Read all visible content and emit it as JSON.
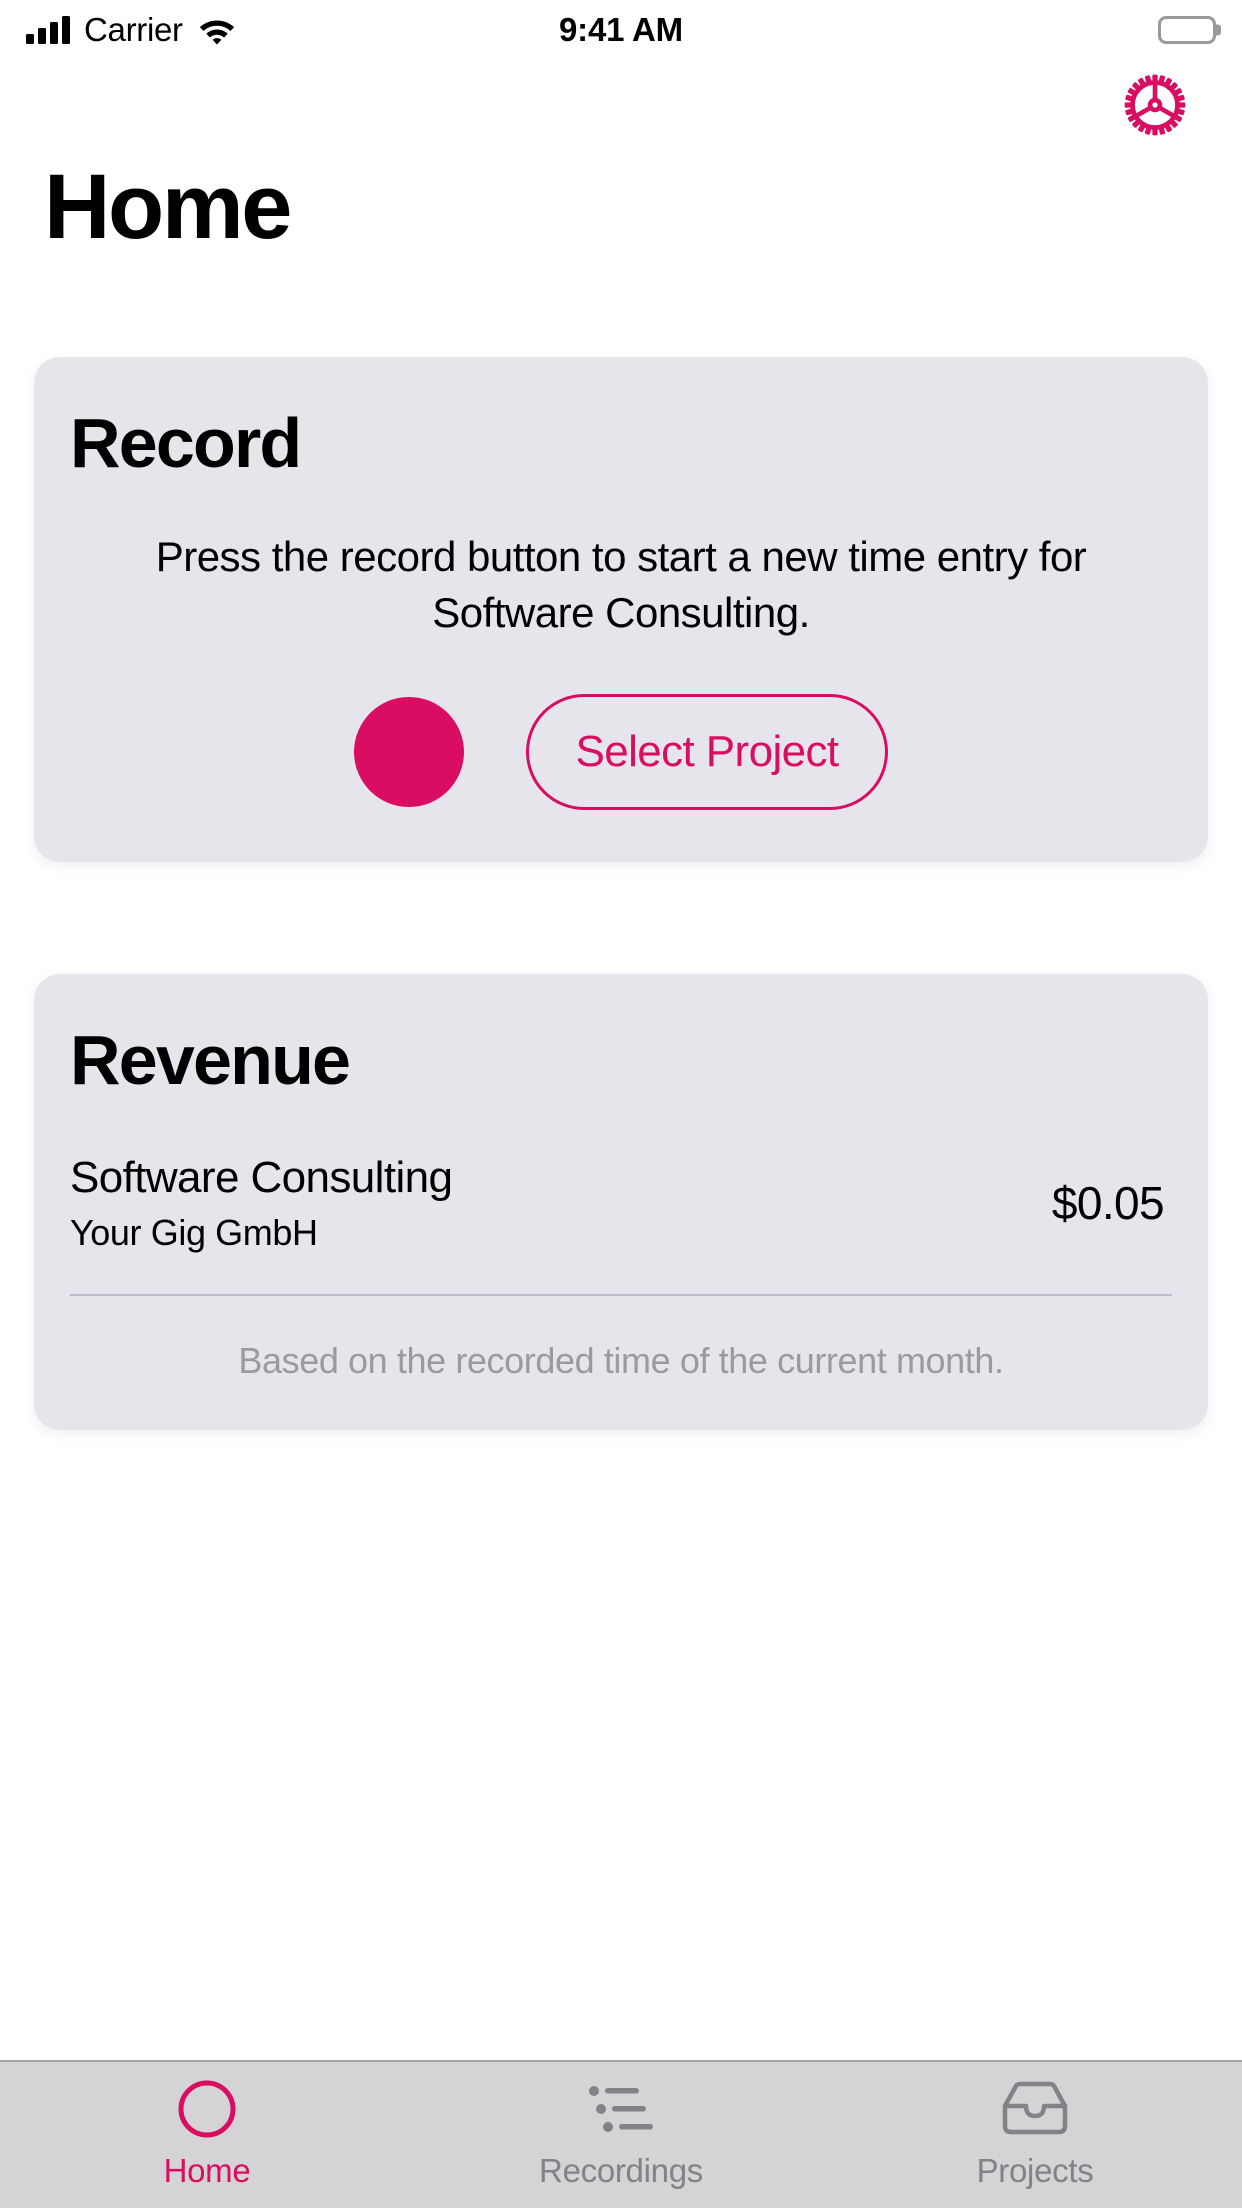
{
  "status_bar": {
    "carrier": "Carrier",
    "time": "9:41 AM",
    "signal_icon": "signal-bars-icon",
    "wifi_icon": "wifi-icon",
    "battery_icon": "battery-full-icon"
  },
  "header": {
    "title": "Home",
    "settings_icon": "gear-icon"
  },
  "record_card": {
    "title": "Record",
    "description": "Press the record button to start a new time entry for Software Consulting.",
    "record_button_label": "record-button",
    "select_project_label": "Select Project"
  },
  "revenue_card": {
    "title": "Revenue",
    "project": "Software Consulting",
    "client": "Your Gig GmbH",
    "amount": "$0.05",
    "note": "Based on the recorded time of the current month."
  },
  "tab_bar": {
    "tabs": [
      {
        "label": "Home",
        "icon": "circle-outline-icon",
        "active": true
      },
      {
        "label": "Recordings",
        "icon": "bulleted-list-icon",
        "active": false
      },
      {
        "label": "Projects",
        "icon": "tray-icon",
        "active": false
      }
    ]
  },
  "colors": {
    "accent": "#D90D62",
    "card_background": "#E6E5EB",
    "page_background": "#FFFFFF",
    "tab_bar_background": "#D4D4D6",
    "muted_text": "#9A9AA0",
    "inactive_tab": "#828287"
  }
}
